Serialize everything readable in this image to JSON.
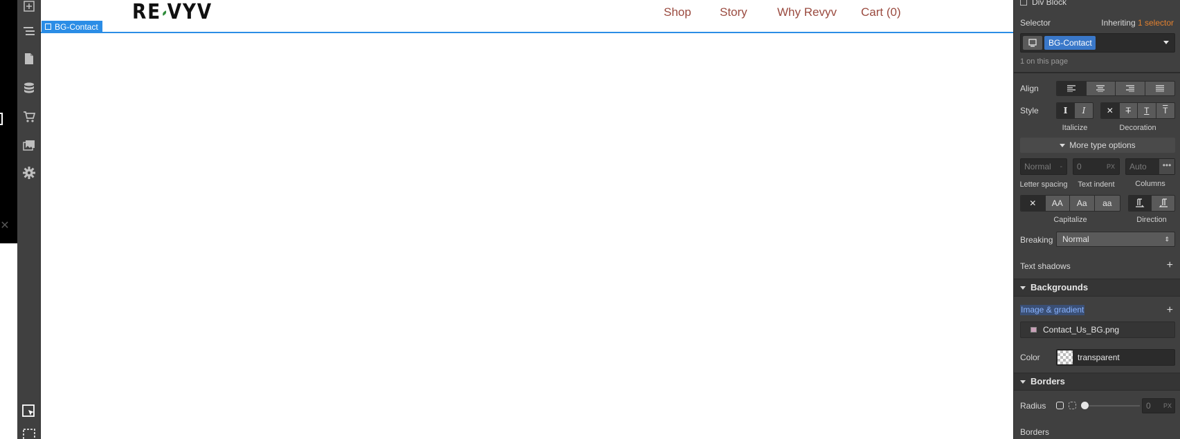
{
  "far_left": {
    "close_glyph": "✕"
  },
  "toolbar": {
    "icons": [
      "add-icon",
      "navigator-icon",
      "pages-icon",
      "cms-icon",
      "ecommerce-icon",
      "assets-icon",
      "settings-icon",
      "select-cursor-icon",
      "marquee-select-icon"
    ]
  },
  "canvas": {
    "logo": {
      "part1": "RE",
      "part2": "VYV"
    },
    "nav": [
      "Shop",
      "Story",
      "Why Revyv",
      "Cart (0)"
    ],
    "selection_tag": "BG-Contact",
    "colors": {
      "selection": "#2b8de6",
      "nav_link": "#9a4a3f"
    }
  },
  "panel": {
    "top_item": "Div Block",
    "selector": {
      "label": "Selector",
      "inheriting": "Inheriting",
      "inheriting_count": "1 selector",
      "tag": "BG-Contact",
      "count_note": "1 on this page"
    },
    "typography": {
      "align_label": "Align",
      "style_label": "Style",
      "italicize_label": "Italicize",
      "decoration_label": "Decoration",
      "more_options": "More type options",
      "letter_spacing": {
        "value": "Normal",
        "unit": "-",
        "label": "Letter spacing"
      },
      "text_indent": {
        "value": "0",
        "unit": "PX",
        "label": "Text indent"
      },
      "columns": {
        "value": "Auto",
        "label": "Columns"
      },
      "capitalize_label": "Capitalize",
      "direction_label": "Direction",
      "case_buttons": [
        "✕",
        "AA",
        "Aa",
        "aa"
      ],
      "breaking_label": "Breaking",
      "breaking_value": "Normal",
      "text_shadows_label": "Text shadows"
    },
    "backgrounds": {
      "header": "Backgrounds",
      "image_gradient_label": "Image & gradient",
      "image_file": "Contact_Us_BG.png",
      "color_label": "Color",
      "color_value": "transparent"
    },
    "borders": {
      "header": "Borders",
      "radius_label": "Radius",
      "radius_value": "0",
      "radius_unit": "PX",
      "borders_label": "Borders"
    },
    "colors": {
      "panel_bg": "#404040",
      "tag_bg": "#3a78c9",
      "accent_orange": "#e3812f"
    }
  }
}
